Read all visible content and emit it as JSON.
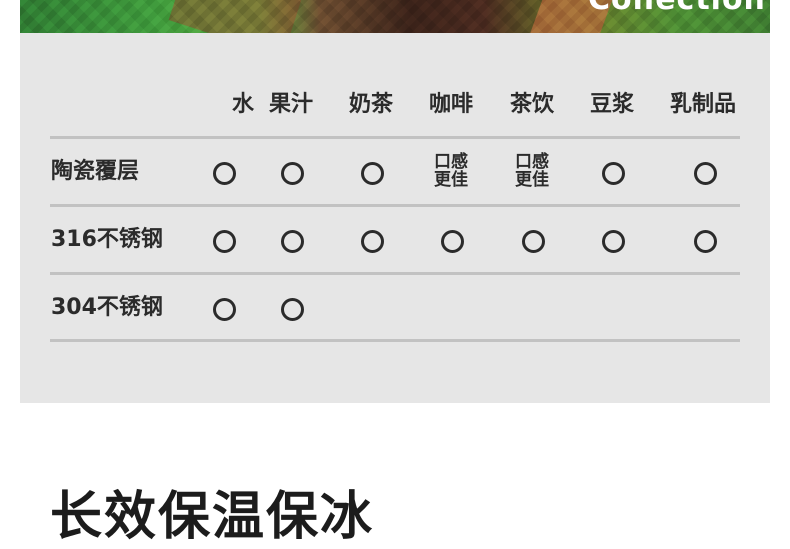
{
  "banner": {
    "left_text": "",
    "right_text": "Collection"
  },
  "table": {
    "columns": [
      "水",
      "果汁",
      "奶茶",
      "咖啡",
      "茶饮",
      "豆浆",
      "乳制品"
    ],
    "rows": [
      {
        "label": "陶瓷覆层",
        "cells": [
          "circle",
          "circle",
          "circle",
          "口感\n更佳",
          "口感\n更佳",
          "circle",
          "circle"
        ]
      },
      {
        "label": "316不锈钢",
        "cells": [
          "circle",
          "circle",
          "circle",
          "circle",
          "circle",
          "circle",
          "circle"
        ]
      },
      {
        "label": "304不锈钢",
        "cells": [
          "circle",
          "circle",
          "",
          "",
          "",
          "",
          ""
        ]
      }
    ],
    "note_line1": "口感",
    "note_line2": "更佳"
  },
  "bottom": {
    "title": "长效保温保冰"
  }
}
